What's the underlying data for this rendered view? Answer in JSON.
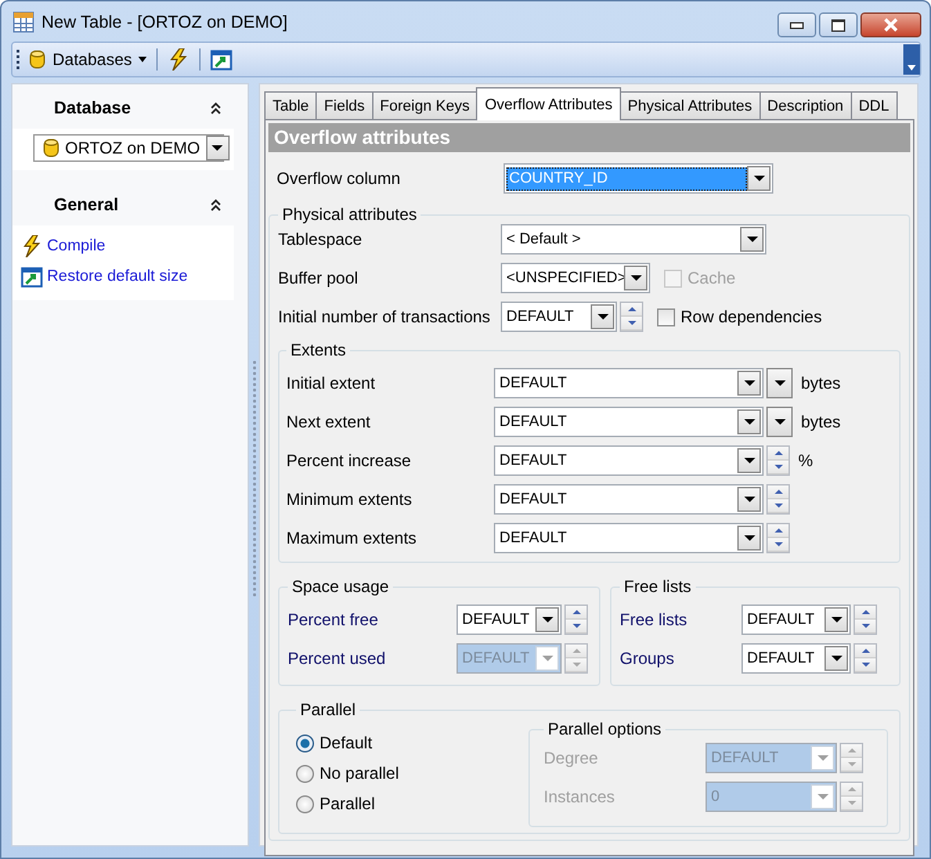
{
  "window": {
    "title": "New Table - [ORTOZ on DEMO]"
  },
  "toolbar": {
    "databases_label": "Databases"
  },
  "sidebar": {
    "sections": [
      {
        "title": "Database",
        "expanded": true
      },
      {
        "title": "General",
        "expanded": true
      }
    ],
    "database": "ORTOZ on DEMO",
    "links": [
      {
        "label": "Compile",
        "kind": "compile"
      },
      {
        "label": "Restore default size",
        "kind": "restore"
      }
    ]
  },
  "tabs": [
    {
      "label": "Table",
      "selected": false
    },
    {
      "label": "Fields",
      "selected": false
    },
    {
      "label": "Foreign Keys",
      "selected": false
    },
    {
      "label": "Overflow Attributes",
      "selected": true
    },
    {
      "label": "Physical Attributes",
      "selected": false
    },
    {
      "label": "Description",
      "selected": false
    },
    {
      "label": "DDL",
      "selected": false
    }
  ],
  "panel": {
    "title": "Overflow attributes",
    "overflow_column": {
      "label": "Overflow column",
      "value": "COUNTRY_ID",
      "focused": true
    },
    "physical": {
      "title": "Physical attributes",
      "tablespace": {
        "label": "Tablespace",
        "value": "< Default >"
      },
      "buffer_pool": {
        "label": "Buffer pool",
        "value": "<UNSPECIFIED>"
      },
      "cache": {
        "label": "Cache",
        "checked": false,
        "disabled": true
      },
      "transactions": {
        "label": "Initial number of transactions",
        "value": "DEFAULT"
      },
      "row_dependencies": {
        "label": "Row dependencies",
        "checked": false,
        "disabled": false
      }
    },
    "extents": {
      "title": "Extents",
      "rows": [
        {
          "label": "Initial extent",
          "value": "DEFAULT",
          "kind": "unit_dropdown",
          "unit": "bytes"
        },
        {
          "label": "Next extent",
          "value": "DEFAULT",
          "kind": "unit_dropdown",
          "unit": "bytes"
        },
        {
          "label": "Percent increase",
          "value": "DEFAULT",
          "kind": "spinner",
          "unit": "%"
        },
        {
          "label": "Minimum extents",
          "value": "DEFAULT",
          "kind": "spinner"
        },
        {
          "label": "Maximum extents",
          "value": "DEFAULT",
          "kind": "spinner"
        }
      ]
    },
    "space_usage": {
      "title": "Space usage",
      "rows": [
        {
          "label": "Percent free",
          "value": "DEFAULT",
          "disabled": false
        },
        {
          "label": "Percent used",
          "value": "DEFAULT",
          "disabled": true
        }
      ]
    },
    "free_lists": {
      "title": "Free lists",
      "rows": [
        {
          "label": "Free lists",
          "value": "DEFAULT",
          "disabled": false
        },
        {
          "label": "Groups",
          "value": "DEFAULT",
          "disabled": false
        }
      ]
    },
    "parallel": {
      "title": "Parallel",
      "options": [
        {
          "label": "Default",
          "selected": true
        },
        {
          "label": "No parallel",
          "selected": false
        },
        {
          "label": "Parallel",
          "selected": false
        }
      ],
      "options_group": {
        "title": "Parallel options",
        "disabled": true,
        "rows": [
          {
            "label": "Degree",
            "value": "DEFAULT"
          },
          {
            "label": "Instances",
            "value": "0"
          }
        ]
      }
    }
  }
}
